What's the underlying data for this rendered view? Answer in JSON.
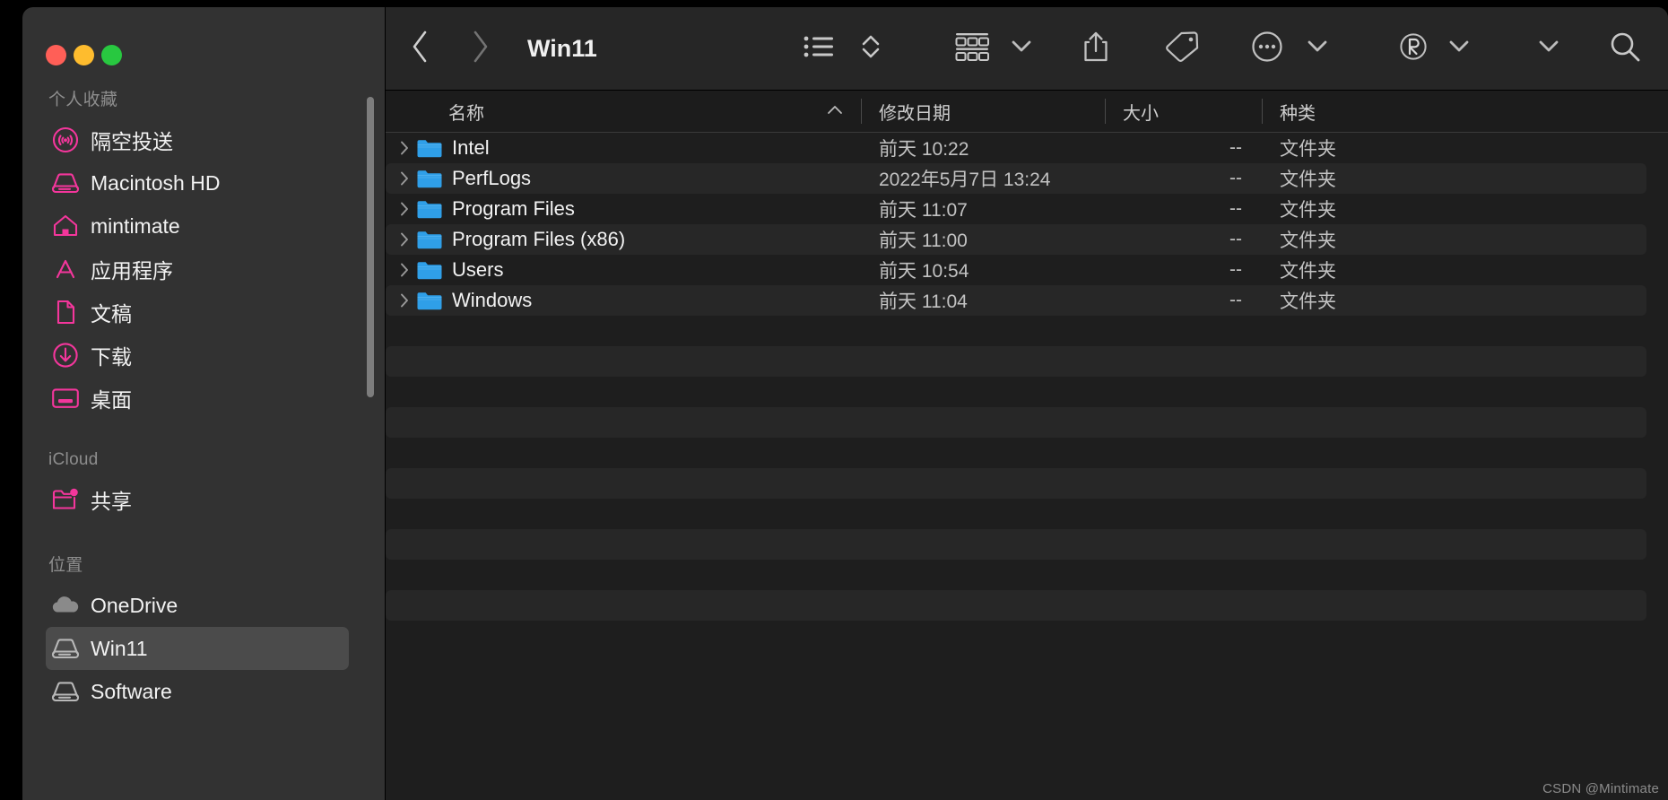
{
  "window": {
    "traffic_lights": [
      {
        "name": "close",
        "color": "#ff5f57"
      },
      {
        "name": "minimize",
        "color": "#febc2e"
      },
      {
        "name": "maximize",
        "color": "#28c840"
      }
    ]
  },
  "sidebar": {
    "accent_color": "#f4369c",
    "selected_bg": "#4b4b4b",
    "groups": [
      {
        "title": "个人收藏",
        "items": [
          {
            "label": "隔空投送",
            "icon": "airdrop-icon",
            "color": "#f4369c",
            "selected": false
          },
          {
            "label": "Macintosh HD",
            "icon": "harddisk-icon",
            "color": "#f4369c",
            "selected": false
          },
          {
            "label": "mintimate",
            "icon": "home-icon",
            "color": "#f4369c",
            "selected": false
          },
          {
            "label": "应用程序",
            "icon": "applications-icon",
            "color": "#f4369c",
            "selected": false
          },
          {
            "label": "文稿",
            "icon": "document-icon",
            "color": "#f4369c",
            "selected": false
          },
          {
            "label": "下载",
            "icon": "download-icon",
            "color": "#f4369c",
            "selected": false
          },
          {
            "label": "桌面",
            "icon": "desktop-icon",
            "color": "#f4369c",
            "selected": false
          }
        ]
      },
      {
        "title": "iCloud",
        "items": [
          {
            "label": "共享",
            "icon": "shared-folder-icon",
            "color": "#f4369c",
            "selected": false
          }
        ]
      },
      {
        "title": "位置",
        "items": [
          {
            "label": "OneDrive",
            "icon": "cloud-icon",
            "color": "#9a9a9a",
            "selected": false
          },
          {
            "label": "Win11",
            "icon": "harddisk-icon",
            "color": "#b8b8b8",
            "selected": true
          },
          {
            "label": "Software",
            "icon": "harddisk-icon",
            "color": "#b8b8b8",
            "selected": false
          }
        ]
      }
    ]
  },
  "toolbar": {
    "back_label": "chevron-left-icon",
    "forward_label": "chevron-right-icon",
    "title": "Win11",
    "buttons": [
      {
        "name": "view-as-list-button",
        "icon": "list-view-icon"
      },
      {
        "name": "view-options-stepper",
        "icon": "updown-chevrons-icon"
      },
      {
        "name": "group-by-button",
        "icon": "group-grid-icon"
      },
      {
        "name": "group-by-chevron",
        "icon": "chevron-down-icon"
      },
      {
        "name": "share-button",
        "icon": "share-icon"
      },
      {
        "name": "tag-button",
        "icon": "tag-icon"
      },
      {
        "name": "more-actions-button",
        "icon": "ellipsis-circle-icon"
      },
      {
        "name": "more-actions-chevron",
        "icon": "chevron-down-icon"
      },
      {
        "name": "registered-button",
        "icon": "registered-r-icon"
      },
      {
        "name": "registered-chevron",
        "icon": "chevron-down-icon"
      },
      {
        "name": "extra-chevron",
        "icon": "chevron-down-icon"
      },
      {
        "name": "search-button",
        "icon": "search-icon"
      }
    ]
  },
  "file_table": {
    "columns": [
      {
        "key": "name",
        "label": "名称",
        "sorted": true,
        "sort_dir": "asc",
        "sort_caret": "⌃"
      },
      {
        "key": "date",
        "label": "修改日期",
        "sorted": false,
        "sort_dir": "",
        "sort_caret": ""
      },
      {
        "key": "size",
        "label": "大小",
        "sorted": false,
        "sort_dir": "",
        "sort_caret": ""
      },
      {
        "key": "kind",
        "label": "种类",
        "sorted": false,
        "sort_dir": "",
        "sort_caret": ""
      }
    ],
    "rows": [
      {
        "name": "Intel",
        "date": "前天 10:22",
        "size": "--",
        "kind": "文件夹",
        "expandable": true,
        "icon": "folder-icon"
      },
      {
        "name": "PerfLogs",
        "date": "2022年5月7日 13:24",
        "size": "--",
        "kind": "文件夹",
        "expandable": true,
        "icon": "folder-icon"
      },
      {
        "name": "Program Files",
        "date": "前天 11:07",
        "size": "--",
        "kind": "文件夹",
        "expandable": true,
        "icon": "folder-icon"
      },
      {
        "name": "Program Files (x86)",
        "date": "前天 11:00",
        "size": "--",
        "kind": "文件夹",
        "expandable": true,
        "icon": "folder-icon"
      },
      {
        "name": "Users",
        "date": "前天 10:54",
        "size": "--",
        "kind": "文件夹",
        "expandable": true,
        "icon": "folder-icon"
      },
      {
        "name": "Windows",
        "date": "前天 11:04",
        "size": "--",
        "kind": "文件夹",
        "expandable": true,
        "icon": "folder-icon"
      }
    ],
    "folder_color": "#2f9fe8",
    "empty_stripe_count": 11,
    "disclosure_glyph": "›"
  },
  "watermark": {
    "text": "CSDN @Mintimate"
  }
}
